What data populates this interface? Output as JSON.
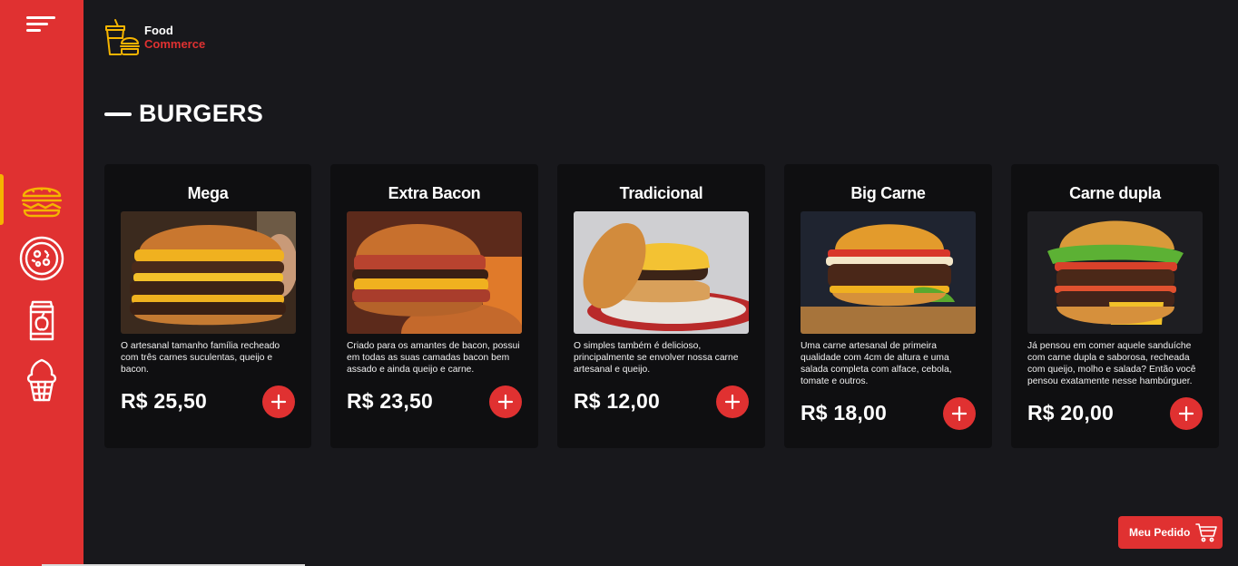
{
  "app": {
    "logo_line1": "Food",
    "logo_line2": "Commerce"
  },
  "sidebar": {
    "items": [
      {
        "icon": "burger-icon",
        "active": true
      },
      {
        "icon": "pizza-icon",
        "active": false
      },
      {
        "icon": "soda-can-icon",
        "active": false
      },
      {
        "icon": "ice-cream-icon",
        "active": false
      }
    ]
  },
  "section": {
    "title": "BURGERS"
  },
  "products": [
    {
      "name": "Mega",
      "description": "O artesanal tamanho família recheado com três carnes suculentas, queijo e bacon.",
      "price": "R$ 25,50"
    },
    {
      "name": "Extra Bacon",
      "description": "Criado para os amantes de bacon, possui em todas as suas camadas bacon bem assado e ainda queijo e carne.",
      "price": "R$ 23,50"
    },
    {
      "name": "Tradicional",
      "description": "O simples também é delicioso, principalmente se envolver nossa carne artesanal e queijo.",
      "price": "R$ 12,00"
    },
    {
      "name": "Big Carne",
      "description": "Uma carne artesanal de primeira qualidade com 4cm de altura e uma salada completa com alface, cebola, tomate e outros.",
      "price": "R$ 18,00"
    },
    {
      "name": "Carne dupla",
      "description": "Já pensou em comer aquele sanduíche com carne dupla e saborosa, recheada com queijo, molho e salada? Então você pensou exatamente nesse hambúrguer.",
      "price": "R$ 20,00"
    }
  ],
  "order_button": {
    "label": "Meu Pedido",
    "icon": "cart-icon"
  },
  "colors": {
    "background": "#18181c",
    "card": "#0f0f11",
    "accent": "#e03131",
    "highlight": "#f5b400"
  }
}
